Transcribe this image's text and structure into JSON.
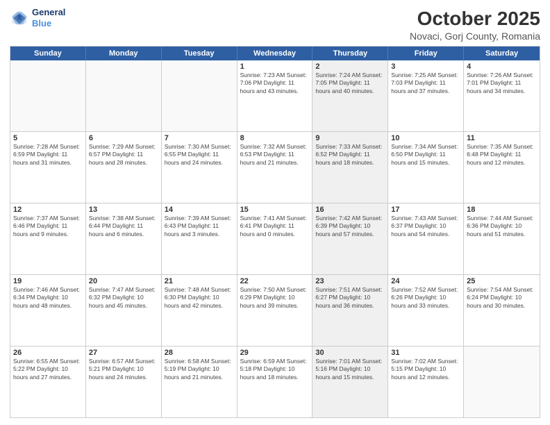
{
  "header": {
    "logo_line1": "General",
    "logo_line2": "Blue",
    "title": "October 2025",
    "subtitle": "Novaci, Gorj County, Romania"
  },
  "days_of_week": [
    "Sunday",
    "Monday",
    "Tuesday",
    "Wednesday",
    "Thursday",
    "Friday",
    "Saturday"
  ],
  "weeks": [
    [
      {
        "day": "",
        "info": "",
        "shaded": false,
        "empty": true
      },
      {
        "day": "",
        "info": "",
        "shaded": false,
        "empty": true
      },
      {
        "day": "",
        "info": "",
        "shaded": false,
        "empty": true
      },
      {
        "day": "1",
        "info": "Sunrise: 7:23 AM\nSunset: 7:06 PM\nDaylight: 11 hours\nand 43 minutes.",
        "shaded": false,
        "empty": false
      },
      {
        "day": "2",
        "info": "Sunrise: 7:24 AM\nSunset: 7:05 PM\nDaylight: 11 hours\nand 40 minutes.",
        "shaded": true,
        "empty": false
      },
      {
        "day": "3",
        "info": "Sunrise: 7:25 AM\nSunset: 7:03 PM\nDaylight: 11 hours\nand 37 minutes.",
        "shaded": false,
        "empty": false
      },
      {
        "day": "4",
        "info": "Sunrise: 7:26 AM\nSunset: 7:01 PM\nDaylight: 11 hours\nand 34 minutes.",
        "shaded": false,
        "empty": false
      }
    ],
    [
      {
        "day": "5",
        "info": "Sunrise: 7:28 AM\nSunset: 6:59 PM\nDaylight: 11 hours\nand 31 minutes.",
        "shaded": false,
        "empty": false
      },
      {
        "day": "6",
        "info": "Sunrise: 7:29 AM\nSunset: 6:57 PM\nDaylight: 11 hours\nand 28 minutes.",
        "shaded": false,
        "empty": false
      },
      {
        "day": "7",
        "info": "Sunrise: 7:30 AM\nSunset: 6:55 PM\nDaylight: 11 hours\nand 24 minutes.",
        "shaded": false,
        "empty": false
      },
      {
        "day": "8",
        "info": "Sunrise: 7:32 AM\nSunset: 6:53 PM\nDaylight: 11 hours\nand 21 minutes.",
        "shaded": false,
        "empty": false
      },
      {
        "day": "9",
        "info": "Sunrise: 7:33 AM\nSunset: 6:52 PM\nDaylight: 11 hours\nand 18 minutes.",
        "shaded": true,
        "empty": false
      },
      {
        "day": "10",
        "info": "Sunrise: 7:34 AM\nSunset: 6:50 PM\nDaylight: 11 hours\nand 15 minutes.",
        "shaded": false,
        "empty": false
      },
      {
        "day": "11",
        "info": "Sunrise: 7:35 AM\nSunset: 6:48 PM\nDaylight: 11 hours\nand 12 minutes.",
        "shaded": false,
        "empty": false
      }
    ],
    [
      {
        "day": "12",
        "info": "Sunrise: 7:37 AM\nSunset: 6:46 PM\nDaylight: 11 hours\nand 9 minutes.",
        "shaded": false,
        "empty": false
      },
      {
        "day": "13",
        "info": "Sunrise: 7:38 AM\nSunset: 6:44 PM\nDaylight: 11 hours\nand 6 minutes.",
        "shaded": false,
        "empty": false
      },
      {
        "day": "14",
        "info": "Sunrise: 7:39 AM\nSunset: 6:43 PM\nDaylight: 11 hours\nand 3 minutes.",
        "shaded": false,
        "empty": false
      },
      {
        "day": "15",
        "info": "Sunrise: 7:41 AM\nSunset: 6:41 PM\nDaylight: 11 hours\nand 0 minutes.",
        "shaded": false,
        "empty": false
      },
      {
        "day": "16",
        "info": "Sunrise: 7:42 AM\nSunset: 6:39 PM\nDaylight: 10 hours\nand 57 minutes.",
        "shaded": true,
        "empty": false
      },
      {
        "day": "17",
        "info": "Sunrise: 7:43 AM\nSunset: 6:37 PM\nDaylight: 10 hours\nand 54 minutes.",
        "shaded": false,
        "empty": false
      },
      {
        "day": "18",
        "info": "Sunrise: 7:44 AM\nSunset: 6:36 PM\nDaylight: 10 hours\nand 51 minutes.",
        "shaded": false,
        "empty": false
      }
    ],
    [
      {
        "day": "19",
        "info": "Sunrise: 7:46 AM\nSunset: 6:34 PM\nDaylight: 10 hours\nand 48 minutes.",
        "shaded": false,
        "empty": false
      },
      {
        "day": "20",
        "info": "Sunrise: 7:47 AM\nSunset: 6:32 PM\nDaylight: 10 hours\nand 45 minutes.",
        "shaded": false,
        "empty": false
      },
      {
        "day": "21",
        "info": "Sunrise: 7:48 AM\nSunset: 6:30 PM\nDaylight: 10 hours\nand 42 minutes.",
        "shaded": false,
        "empty": false
      },
      {
        "day": "22",
        "info": "Sunrise: 7:50 AM\nSunset: 6:29 PM\nDaylight: 10 hours\nand 39 minutes.",
        "shaded": false,
        "empty": false
      },
      {
        "day": "23",
        "info": "Sunrise: 7:51 AM\nSunset: 6:27 PM\nDaylight: 10 hours\nand 36 minutes.",
        "shaded": true,
        "empty": false
      },
      {
        "day": "24",
        "info": "Sunrise: 7:52 AM\nSunset: 6:26 PM\nDaylight: 10 hours\nand 33 minutes.",
        "shaded": false,
        "empty": false
      },
      {
        "day": "25",
        "info": "Sunrise: 7:54 AM\nSunset: 6:24 PM\nDaylight: 10 hours\nand 30 minutes.",
        "shaded": false,
        "empty": false
      }
    ],
    [
      {
        "day": "26",
        "info": "Sunrise: 6:55 AM\nSunset: 5:22 PM\nDaylight: 10 hours\nand 27 minutes.",
        "shaded": false,
        "empty": false
      },
      {
        "day": "27",
        "info": "Sunrise: 6:57 AM\nSunset: 5:21 PM\nDaylight: 10 hours\nand 24 minutes.",
        "shaded": false,
        "empty": false
      },
      {
        "day": "28",
        "info": "Sunrise: 6:58 AM\nSunset: 5:19 PM\nDaylight: 10 hours\nand 21 minutes.",
        "shaded": false,
        "empty": false
      },
      {
        "day": "29",
        "info": "Sunrise: 6:59 AM\nSunset: 5:18 PM\nDaylight: 10 hours\nand 18 minutes.",
        "shaded": false,
        "empty": false
      },
      {
        "day": "30",
        "info": "Sunrise: 7:01 AM\nSunset: 5:16 PM\nDaylight: 10 hours\nand 15 minutes.",
        "shaded": true,
        "empty": false
      },
      {
        "day": "31",
        "info": "Sunrise: 7:02 AM\nSunset: 5:15 PM\nDaylight: 10 hours\nand 12 minutes.",
        "shaded": false,
        "empty": false
      },
      {
        "day": "",
        "info": "",
        "shaded": false,
        "empty": true
      }
    ]
  ]
}
